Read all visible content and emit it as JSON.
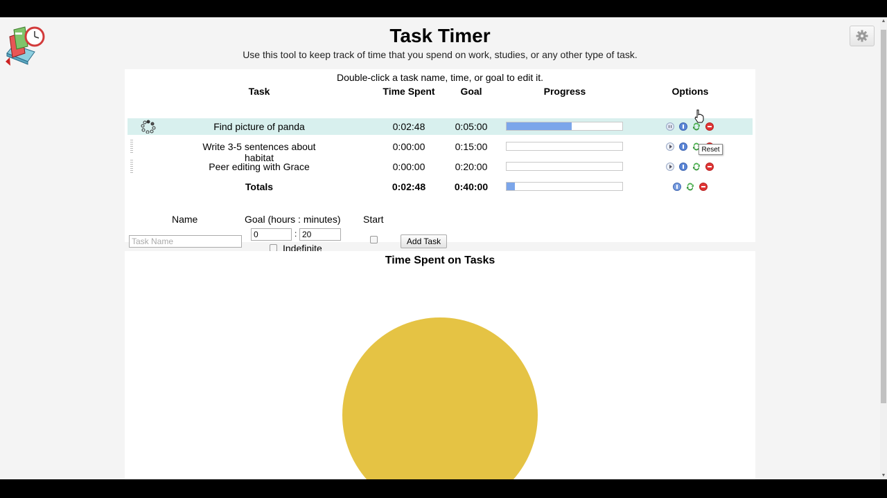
{
  "header": {
    "title": "Task Timer",
    "subtitle": "Use this tool to keep track of time that you spend on work, studies, or any other type of task."
  },
  "hint": "Double-click a task name, time, or goal to edit it.",
  "columns": [
    "Task",
    "Time Spent",
    "Goal",
    "Progress",
    "Options"
  ],
  "tasks": [
    {
      "name": "Find picture of panda",
      "time_spent": "0:02:48",
      "goal": "0:05:00",
      "progress": 0.56,
      "running": true
    },
    {
      "name": "Write 3-5 sentences about habitat",
      "time_spent": "0:00:00",
      "goal": "0:15:00",
      "progress": 0.0,
      "running": false
    },
    {
      "name": "Peer editing with Grace",
      "time_spent": "0:00:00",
      "goal": "0:20:00",
      "progress": 0.0,
      "running": false
    }
  ],
  "totals": {
    "label": "Totals",
    "time_spent": "0:02:48",
    "goal": "0:40:00",
    "progress": 0.07
  },
  "form": {
    "name_label": "Name",
    "goal_label": "Goal (hours : minutes)",
    "start_label": "Start",
    "name_placeholder": "Task Name",
    "hours_value": "0",
    "separator": ":",
    "minutes_value": "20",
    "indefinite_label": "Indefinite",
    "add_button": "Add Task"
  },
  "tooltip": "Reset",
  "chart_data": {
    "type": "pie",
    "title": "Time Spent on Tasks",
    "labels": [
      "Find picture of panda"
    ],
    "values": [
      100
    ],
    "colors": [
      "#e5c344"
    ]
  },
  "colors": {
    "progress_fill": "#7ca6ea",
    "active_row": "#d8f0ee",
    "pie": "#e5c344"
  }
}
